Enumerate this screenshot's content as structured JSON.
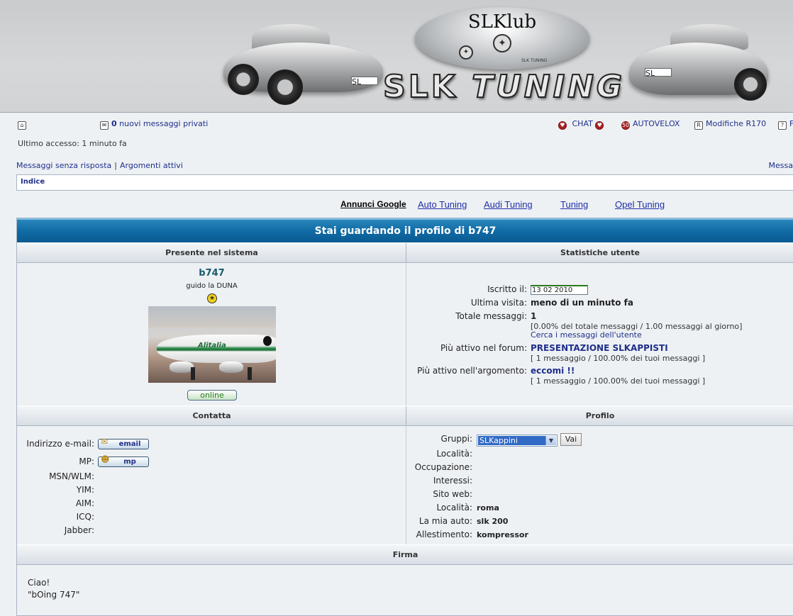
{
  "banner": {
    "logo_top": "SLKlub",
    "logo_small": "SLK TUNING",
    "logo_main_a": "SLK",
    "logo_main_b": "TUNING",
    "plate_left": "SL",
    "plate_right": "SL"
  },
  "topnav": {
    "pm_count": "0",
    "pm_text": " nuovi messaggi privati",
    "chat": "CHAT",
    "autovelox": "AUTOVELOX",
    "modifiche": "Modifiche R170",
    "cut_item": "F"
  },
  "last_visit": "Ultimo accesso: 1 minuto fa",
  "links": {
    "unanswered": "Messaggi senza risposta",
    "separator": "|",
    "active": "Argomenti attivi",
    "right_cut": "Messa"
  },
  "breadcrumb": "Indice",
  "ads": {
    "title": "Annunci Google",
    "items": [
      "Auto Tuning",
      "Audi Tuning",
      "Tuning",
      "Opel Tuning"
    ]
  },
  "profile": {
    "title": "Stai guardando il profilo di b747",
    "section_left": "Presente nel sistema",
    "section_right": "Statistiche utente",
    "username": "b747",
    "rank": "guido la DUNA",
    "online": "online",
    "avatar_caption": "Alitalia",
    "stats": {
      "joined_label": "Iscritto il:",
      "joined_value": "13 02 2010",
      "lastvisit_label": "Ultima visita:",
      "lastvisit_value": "meno di un minuto fa",
      "posts_label": "Totale messaggi:",
      "posts_value": "1",
      "posts_detail": "[0.00% del totale messaggi / 1.00 messaggi al giorno]",
      "posts_search": "Cerca i messaggi dell'utente",
      "forum_label": "Più attivo nel forum:",
      "forum_value": "PRESENTAZIONE SLKAPPISTI",
      "forum_detail": "[ 1 messaggio / 100.00% dei tuoi messaggi ]",
      "topic_label": "Più attivo nell'argomento:",
      "topic_value": "eccomi !!",
      "topic_detail": "[ 1 messaggio / 100.00% dei tuoi messaggi ]"
    },
    "contact_header": "Contatta",
    "profile_header": "Profilo",
    "contact": {
      "email_label": "Indirizzo e-mail:",
      "email_btn": "email",
      "mp_label": "MP:",
      "mp_btn": "mp",
      "msn_label": "MSN/WLM:",
      "yim_label": "YIM:",
      "aim_label": "AIM:",
      "icq_label": "ICQ:",
      "jabber_label": "Jabber:"
    },
    "profile_fields": {
      "groups_label": "Gruppi:",
      "groups_value": "SLKappini",
      "go_btn": "Vai",
      "location_label": "Località:",
      "occupation_label": "Occupazione:",
      "interests_label": "Interessi:",
      "website_label": "Sito web:",
      "location2_label": "Località:",
      "location2_value": "roma",
      "car_label": "La mia auto:",
      "car_value": "slk 200",
      "trim_label": "Allestimento:",
      "trim_value": "kompressor"
    },
    "signature_header": "Firma",
    "signature_line1": "Ciao!",
    "signature_line2": "\"bOing 747\""
  }
}
